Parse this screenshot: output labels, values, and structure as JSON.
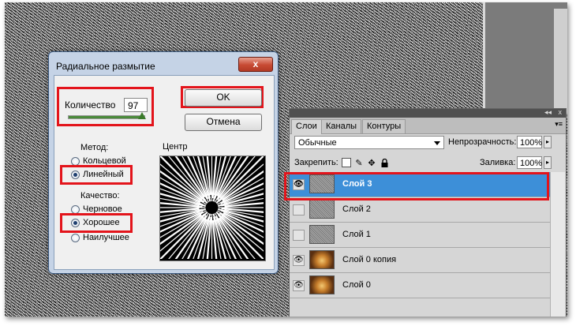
{
  "dialog": {
    "title": "Радиальное размытие",
    "close_glyph": "x",
    "amount_label": "Количество",
    "amount_value": "97",
    "amount_fraction": 0.97,
    "ok_label": "OK",
    "cancel_label": "Отмена",
    "method_label": "Метод:",
    "method_options": [
      "Кольцевой",
      "Линейный"
    ],
    "method_selected": "Линейный",
    "quality_label": "Качество:",
    "quality_options": [
      "Черновое",
      "Хорошее",
      "Наилучшее"
    ],
    "quality_selected": "Хорошее",
    "center_label": "Центр"
  },
  "layers_panel": {
    "collapse_glyph": "◂◂",
    "close_glyph": "x",
    "tabs": [
      "Слои",
      "Каналы",
      "Контуры"
    ],
    "active_tab": "Слои",
    "menu_glyph": "▾≡",
    "blend_mode": "Обычные",
    "opacity_label": "Непрозрачность:",
    "opacity_value": "100%",
    "lock_label": "Закрепить:",
    "fill_label": "Заливка:",
    "fill_value": "100%",
    "layers": [
      {
        "name": "Слой 3",
        "visible": true,
        "selected": true,
        "thumb": "noise"
      },
      {
        "name": "Слой 2",
        "visible": false,
        "selected": false,
        "thumb": "noise"
      },
      {
        "name": "Слой 1",
        "visible": false,
        "selected": false,
        "thumb": "noise"
      },
      {
        "name": "Слой 0 копия",
        "visible": true,
        "selected": false,
        "thumb": "photo"
      },
      {
        "name": "Слой 0",
        "visible": true,
        "selected": false,
        "thumb": "photo"
      }
    ]
  },
  "colors": {
    "highlight_box": "#e3141b",
    "selected_layer": "#3d8fd8",
    "dialog_frame": "#c5d3e6"
  },
  "icons": [
    "close-icon",
    "eye-icon",
    "lock-transparency-icon",
    "brush-icon",
    "move-icon",
    "lock-icon",
    "dropdown-arrow-icon"
  ]
}
